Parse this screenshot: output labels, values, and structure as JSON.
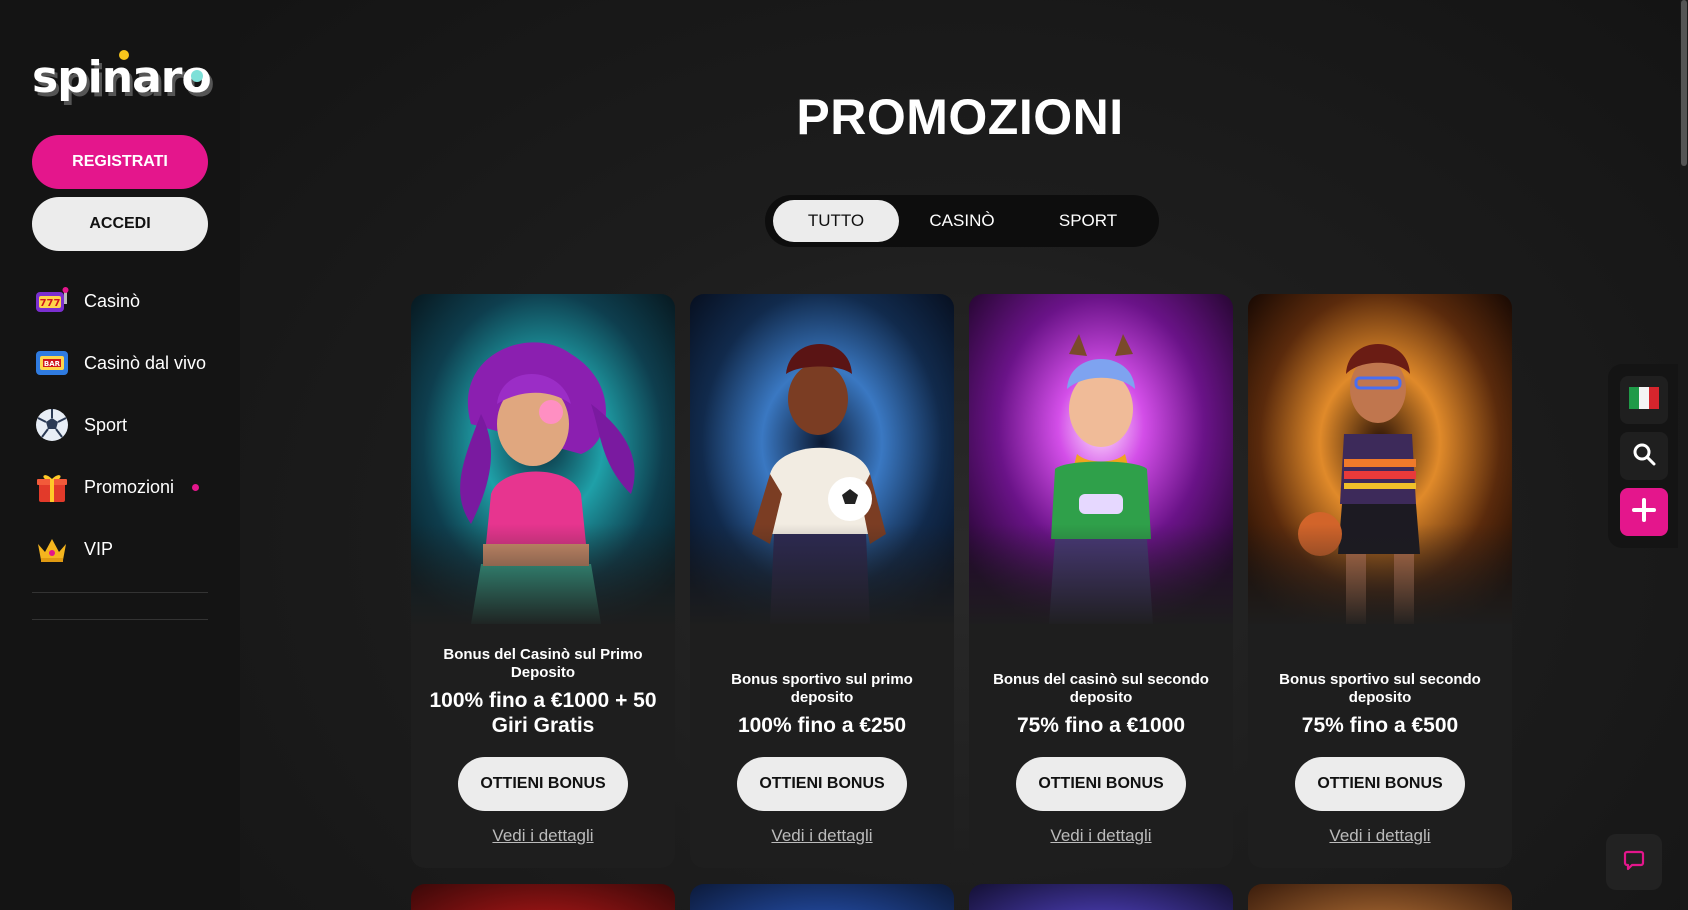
{
  "logo": {
    "text": "spinaro"
  },
  "sidebar": {
    "register_label": "REGISTRATI",
    "login_label": "ACCEDI",
    "items": [
      {
        "label": "Casinò",
        "icon": "slot-777-icon"
      },
      {
        "label": "Casinò dal vivo",
        "icon": "bar-slot-icon"
      },
      {
        "label": "Sport",
        "icon": "football-icon"
      },
      {
        "label": "Promozioni",
        "icon": "gift-icon",
        "badge": true
      },
      {
        "label": "VIP",
        "icon": "crown-icon"
      }
    ]
  },
  "main": {
    "title": "PROMOZIONI",
    "tabs": [
      {
        "label": "TUTTO",
        "active": true
      },
      {
        "label": "CASINÒ",
        "active": false
      },
      {
        "label": "SPORT",
        "active": false
      }
    ],
    "cards": [
      {
        "subtitle": "Bonus del Casinò sul Primo Deposito",
        "headline": "100% fino a €1000 + 50 Giri Gratis",
        "button": "OTTIENI BONUS",
        "link": "Vedi i dettagli",
        "theme": "#1c8d96"
      },
      {
        "subtitle": "Bonus sportivo sul primo deposito",
        "headline": "100% fino a €250",
        "button": "OTTIENI BONUS",
        "link": "Vedi i dettagli",
        "theme": "#2d5f9c"
      },
      {
        "subtitle": "Bonus del casinò sul secondo deposito",
        "headline": "75% fino a €1000",
        "button": "OTTIENI BONUS",
        "link": "Vedi i dettagli",
        "theme": "#a41fc2"
      },
      {
        "subtitle": "Bonus sportivo sul secondo deposito",
        "headline": "75% fino a €500",
        "button": "OTTIENI BONUS",
        "link": "Vedi i dettagli",
        "theme": "#c1641b"
      }
    ]
  },
  "right_widget": {
    "items": [
      "italy-flag-icon",
      "search-icon",
      "plus-icon"
    ]
  },
  "chat": {
    "icon": "chat-icon"
  },
  "colors": {
    "accent": "#e4168c",
    "button_light": "#ececec"
  }
}
